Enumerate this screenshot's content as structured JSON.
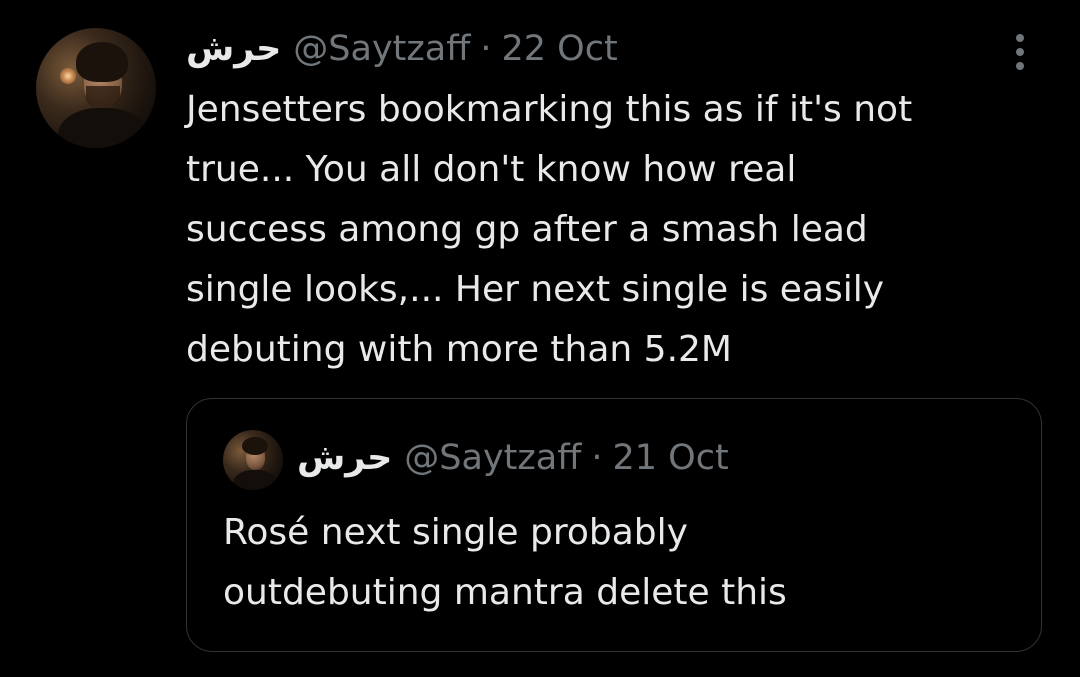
{
  "tweet": {
    "display_name": "حرش",
    "handle": "@Saytzaff",
    "separator": "·",
    "date": "22 Oct",
    "more_icon": "more-vertical-icon",
    "text_lines": [
      "Jensetters bookmarking this as if it's not",
      "true... You all don't know how real",
      "success among gp after a smash lead",
      "single looks,... Her next single is easily",
      "debuting with more than 5.2M"
    ]
  },
  "quoted_tweet": {
    "display_name": "حرش",
    "handle": "@Saytzaff",
    "separator": "·",
    "date": "21 Oct",
    "text_lines": [
      "Rosé next single probably",
      "outdebuting mantra delete this"
    ]
  },
  "colors": {
    "background": "#000000",
    "primary_text": "#e7e9ea",
    "secondary_text": "#71767b",
    "border": "#2f3336"
  }
}
